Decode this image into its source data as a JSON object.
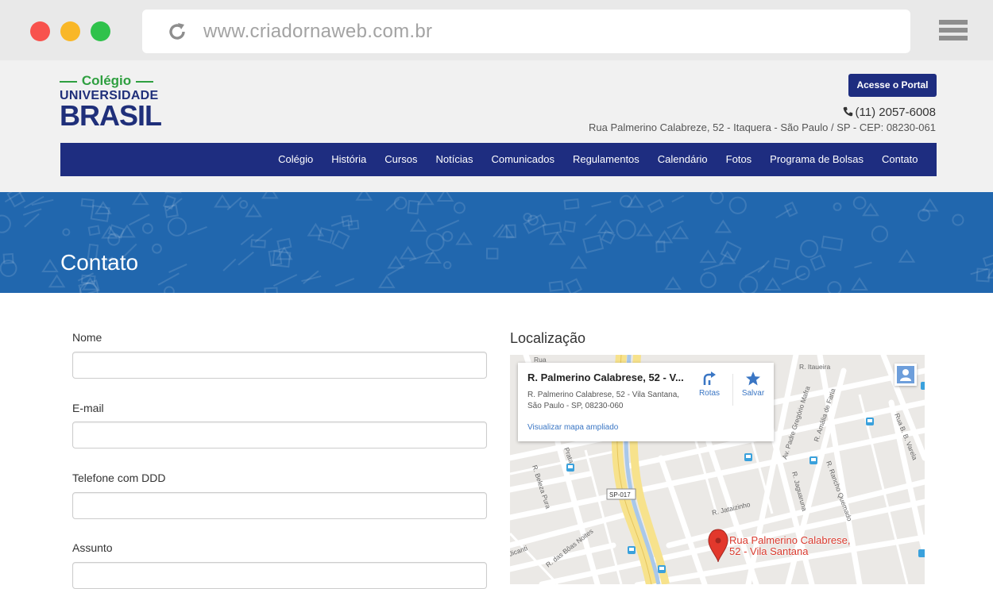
{
  "browser": {
    "url": "www.criadornaweb.com.br"
  },
  "header": {
    "logo": {
      "top": "Colégio",
      "middle": "UNIVERSIDADE",
      "bottom": "BRASIL"
    },
    "portal_button": "Acesse o Portal",
    "phone": "(11) 2057-6008",
    "address": "Rua Palmerino Calabreze, 52 - Itaquera - São Paulo / SP - CEP: 08230-061"
  },
  "nav": {
    "items": [
      "Colégio",
      "História",
      "Cursos",
      "Notícias",
      "Comunicados",
      "Regulamentos",
      "Calendário",
      "Fotos",
      "Programa de Bolsas",
      "Contato"
    ]
  },
  "banner": {
    "title": "Contato"
  },
  "form": {
    "fields": [
      {
        "label": "Nome",
        "value": ""
      },
      {
        "label": "E-mail",
        "value": ""
      },
      {
        "label": "Telefone com DDD",
        "value": ""
      },
      {
        "label": "Assunto",
        "value": ""
      }
    ]
  },
  "location": {
    "title": "Localização",
    "card": {
      "title": "R. Palmerino Calabrese, 52 - V...",
      "address_line1": "R. Palmerino Calabrese, 52 - Vila Santana,",
      "address_line2": "São Paulo - SP, 08230-060",
      "link": "Visualizar mapa ampliado",
      "routes_label": "Rotas",
      "save_label": "Salvar"
    },
    "pin_label_line1": "Rua Palmerino Calabrese,",
    "pin_label_line2": "52 - Vila Santana",
    "street_labels": [
      "R. Itaueira",
      "Av. Padre Gregório Mafra",
      "R. Amália de Faria",
      "Rua B. B. Varela",
      "R. Rancho Quemado",
      "R. Jaguaruna",
      "R. Jataizinho",
      "R. Beleza Pura",
      "SP-017",
      "R. das Bôas Noites",
      "Rua",
      "Prata",
      "Jicanti"
    ]
  },
  "colors": {
    "brand_navy": "#1e2d80",
    "brand_green": "#2e9f3f",
    "banner_blue": "#2167ae",
    "pin_red": "#d93a2e"
  }
}
